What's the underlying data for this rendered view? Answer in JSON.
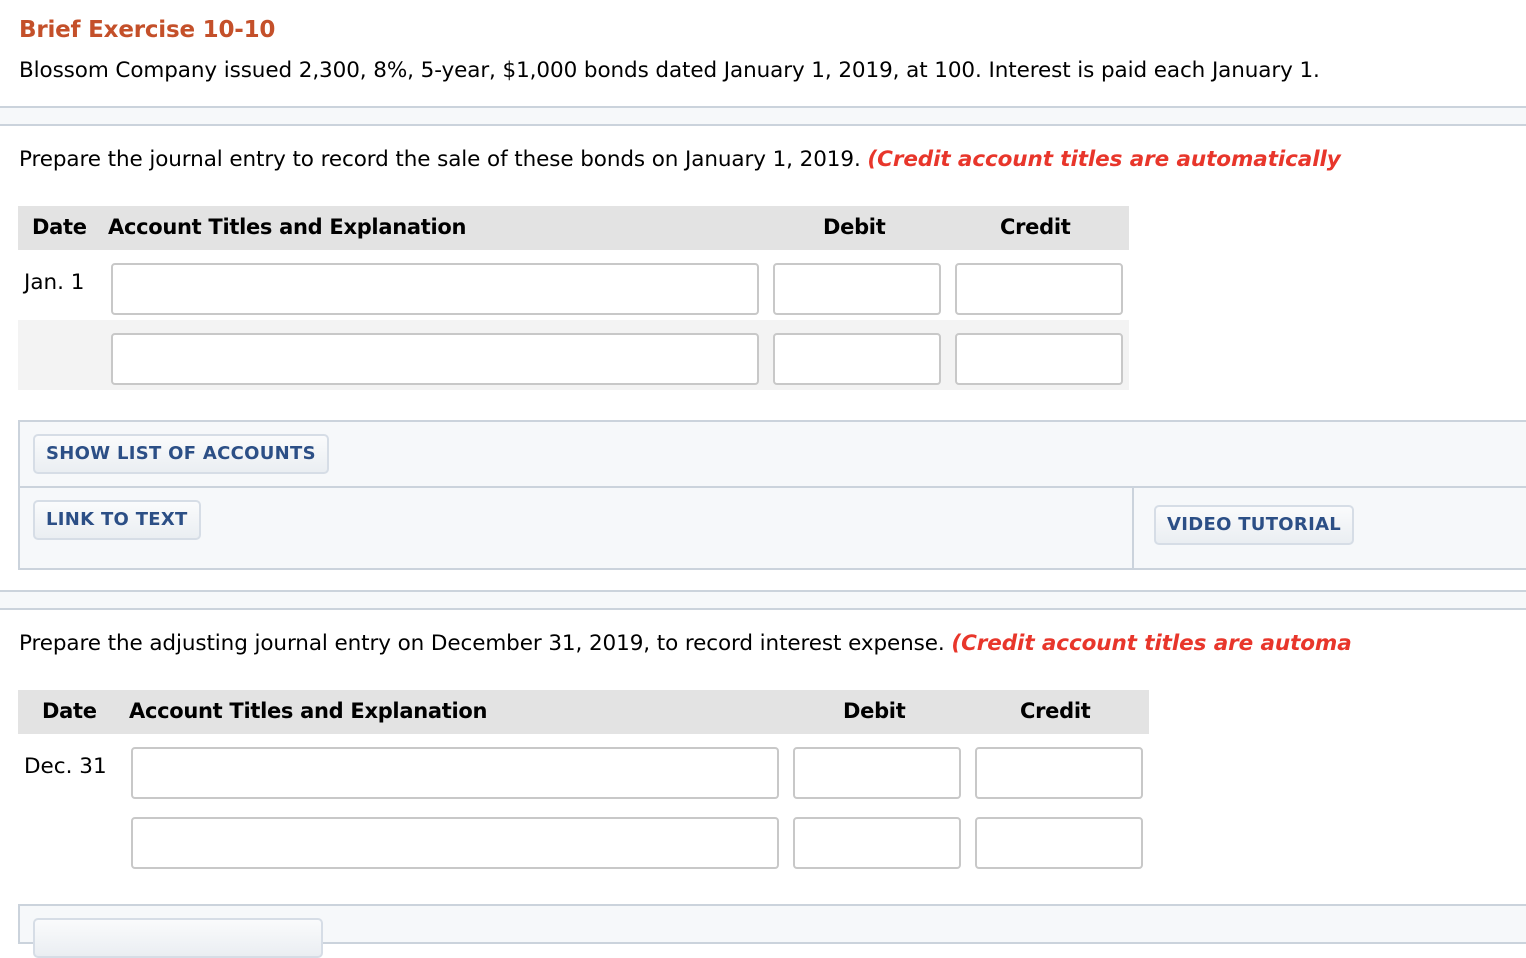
{
  "header": {
    "title": "Brief Exercise 10-10",
    "intro": "Blossom Company issued 2,300, 8%, 5-year, $1,000 bonds dated January 1, 2019, at 100. Interest is paid each January 1."
  },
  "part1": {
    "prompt": "Prepare the journal entry to record the sale of these bonds on January 1, 2019.",
    "note": "(Credit account titles are automatically",
    "columns": {
      "date": "Date",
      "account": "Account Titles and Explanation",
      "debit": "Debit",
      "credit": "Credit"
    },
    "rows": [
      {
        "date": "Jan. 1",
        "account": "",
        "debit": "",
        "credit": ""
      },
      {
        "date": "",
        "account": "",
        "debit": "",
        "credit": ""
      }
    ]
  },
  "tools": {
    "show_list": "SHOW LIST OF ACCOUNTS",
    "link_to_text": "LINK TO TEXT",
    "video_tutorial": "VIDEO TUTORIAL"
  },
  "part2": {
    "prompt": "Prepare the adjusting journal entry on December 31, 2019, to record interest expense.",
    "note": "(Credit account titles are automa",
    "columns": {
      "date": "Date",
      "account": "Account Titles and Explanation",
      "debit": "Debit",
      "credit": "Credit"
    },
    "rows": [
      {
        "date": "Dec. 31",
        "account": "",
        "debit": "",
        "credit": ""
      },
      {
        "date": "",
        "account": "",
        "debit": "",
        "credit": ""
      }
    ]
  }
}
